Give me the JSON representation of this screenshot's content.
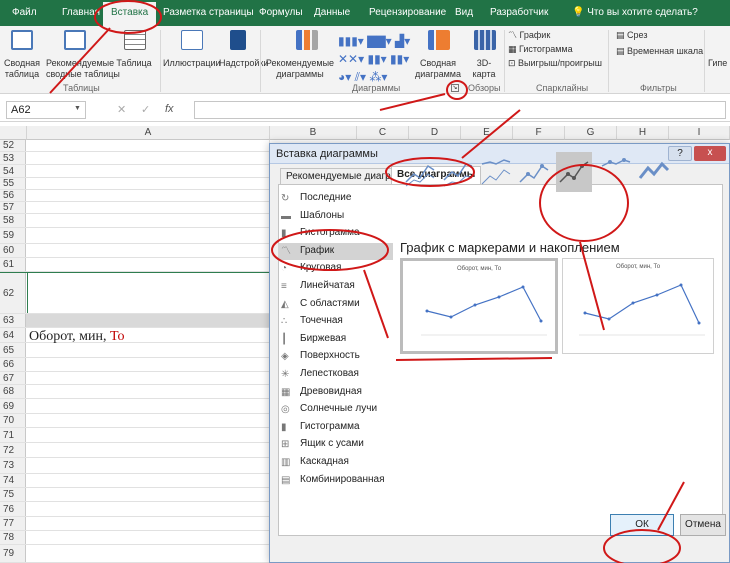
{
  "colors": {
    "excel_green": "#217346",
    "annotation_red": "#d01818",
    "chart_blue": "#4472c4"
  },
  "tabs": [
    "Файл",
    "Главная",
    "Вставка",
    "Разметка страницы",
    "Формулы",
    "Данные",
    "Рецензирование",
    "Вид",
    "Разработчик"
  ],
  "tell_me": "Что вы хотите сделать?",
  "ribbon": {
    "pivot": [
      "Сводная",
      "таблица"
    ],
    "recommended_pivot": [
      "Рекомендуемые",
      "сводные таблицы"
    ],
    "table": "Таблица",
    "tables_group": "Таблицы",
    "illustrations": "Иллюстрации",
    "addins": "Надстройки",
    "recommended_charts": [
      "Рекомендуемые",
      "диаграммы"
    ],
    "pivot_chart": [
      "Сводная",
      "диаграмма"
    ],
    "map3d": [
      "3D-",
      "карта"
    ],
    "charts_group": "Диаграммы",
    "tours_group": "Обзоры",
    "spark_line": "График",
    "spark_column": "Гистограмма",
    "spark_winloss": "Выигрыш/проигрыш",
    "sparklines_group": "Спарклайны",
    "slicer": "Срез",
    "timeline": "Временная шкала",
    "filters_group": "Фильтры",
    "hyperlink_cut": "Гипе"
  },
  "formula_bar": {
    "name_box": "A62",
    "fx": "fx"
  },
  "columns": [
    "A",
    "B",
    "C",
    "D",
    "E",
    "F",
    "G",
    "H",
    "I"
  ],
  "rows": [
    "52",
    "53",
    "54",
    "55",
    "56",
    "57",
    "58",
    "59",
    "60",
    "61",
    "62",
    "63",
    "64",
    "65",
    "66",
    "67",
    "68",
    "69",
    "70",
    "71",
    "72",
    "73",
    "74",
    "75",
    "76",
    "77",
    "78",
    "79"
  ],
  "cell_a64": {
    "main": "Оборот, мин,",
    "accent": "То"
  },
  "dialog": {
    "title": "Вставка диаграммы",
    "help": "?",
    "close": "x",
    "tab_recommended": "Рекомендуемые диаграммы",
    "tab_all": "Все диаграммы",
    "categories": [
      "Последние",
      "Шаблоны",
      "Гистограмма",
      "График",
      "Круговая",
      "Линейчатая",
      "С областями",
      "Точечная",
      "Биржевая",
      "Поверхность",
      "Лепестковая",
      "Древовидная",
      "Солнечные лучи",
      "Гистограмма",
      "Ящик с усами",
      "Каскадная",
      "Комбинированная"
    ],
    "chart_title": "График с маркерами и накоплением",
    "preview_title": "Оборот, мин, То",
    "ok": "ОК",
    "cancel": "Отмена"
  }
}
